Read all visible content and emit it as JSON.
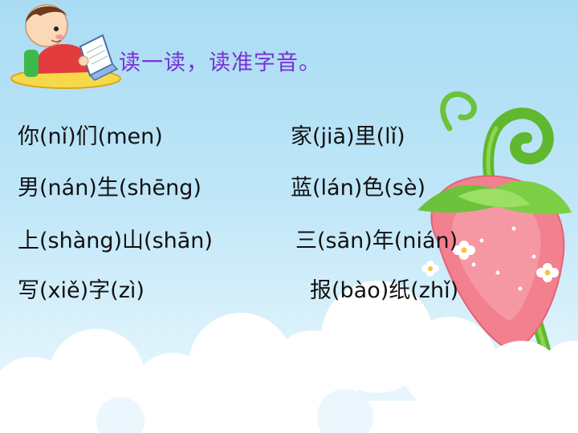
{
  "title": "读一读，读准字音。",
  "rows": [
    {
      "left": "你(nǐ)们(men)",
      "right": "家(jiā)里(lǐ)"
    },
    {
      "left": "男(nán)生(shēng)",
      "right": "蓝(lán)色(sè)"
    },
    {
      "left": "上(shàng)山(shān)",
      "right": "三(sān)年(nián)"
    },
    {
      "left": "写(xiě)字(zì)",
      "right": "报(bào)纸(zhǐ)"
    }
  ],
  "icons": [
    "boy-reading-book-icon",
    "strawberry-vine-icon",
    "cloud-icon"
  ]
}
